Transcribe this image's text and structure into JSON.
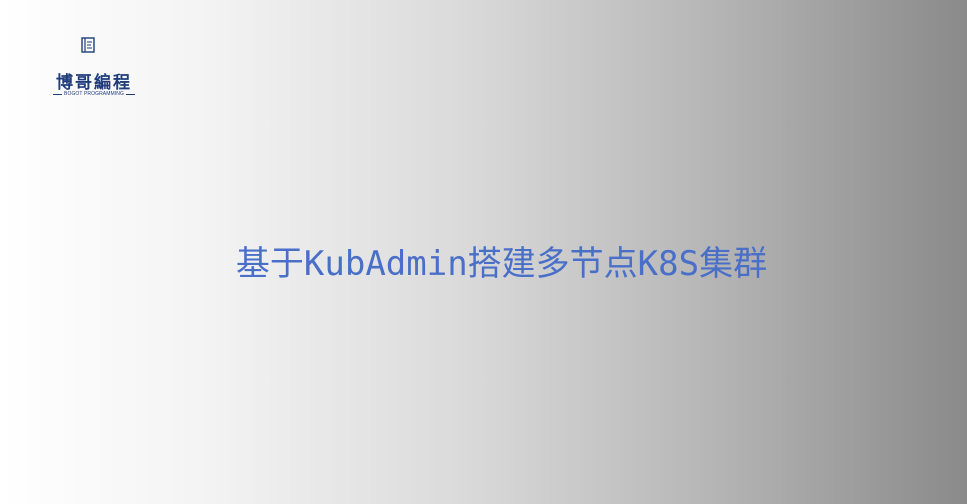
{
  "logo": {
    "name": "博哥編程",
    "subtitle": "BOGOT PROGRAMMING",
    "icon": "book-icon",
    "brand_color": "#1f3c7c"
  },
  "slide": {
    "title": "基于KubAdmin搭建多节点K8S集群",
    "title_color": "#4a6fc8"
  }
}
